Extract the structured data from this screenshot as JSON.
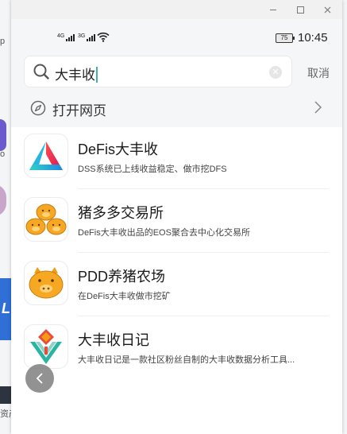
{
  "background": {
    "fragments": [
      "p",
      "o",
      "资产"
    ]
  },
  "statusbar": {
    "signal1_tag": "4G",
    "signal2_tag": "3G",
    "battery": "75",
    "time": "10:45"
  },
  "search": {
    "value": "大丰收",
    "cancel_label": "取消"
  },
  "open_web": {
    "label": "打开网页"
  },
  "results": [
    {
      "title": "DeFis大丰收",
      "desc": "DSS系统已上线收益稳定、做市挖DFS",
      "icon": "defis-logo-icon"
    },
    {
      "title": "猪多多交易所",
      "desc": "DeFis大丰收出品的EOS聚合去中心化交易所",
      "icon": "three-pigs-icon"
    },
    {
      "title": "PDD养猪农场",
      "desc": "在DeFis大丰收做市挖矿",
      "icon": "pig-icon"
    },
    {
      "title": "大丰收日记",
      "desc": "大丰收日记是一款社区粉丝自制的大丰收数据分析工具...",
      "icon": "diary-logo-icon"
    }
  ],
  "colors": {
    "caret": "#3bb5a8",
    "header_bg": "#f5f6f8"
  }
}
